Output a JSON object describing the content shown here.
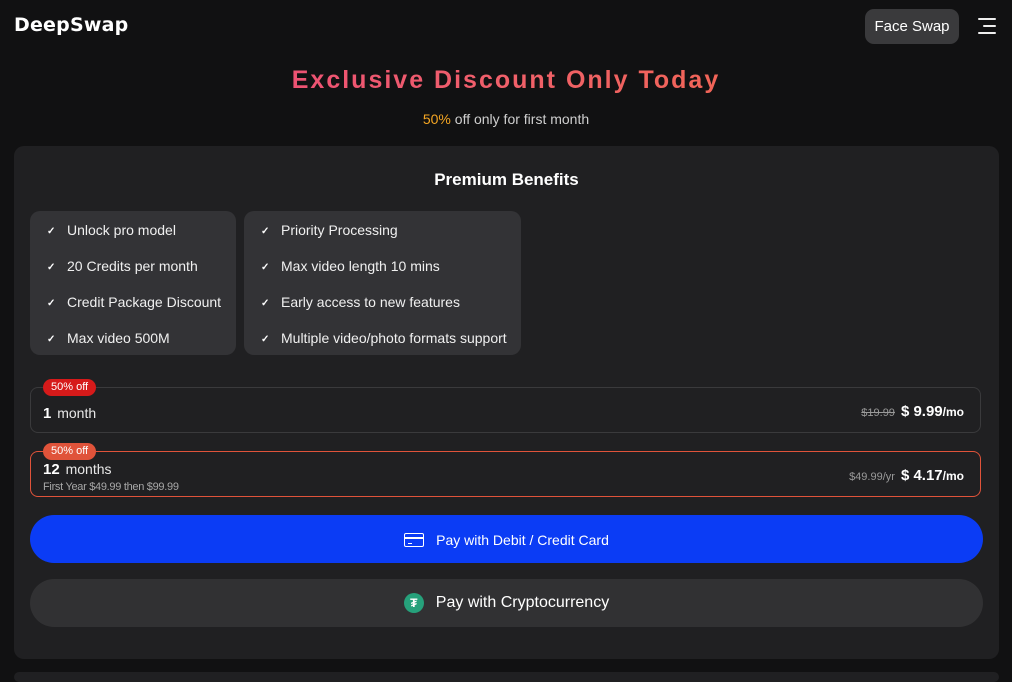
{
  "header": {
    "logo_text": "DeepSwap",
    "face_swap_label": "Face Swap",
    "menu_icon": "hamburger-menu-icon"
  },
  "promo": {
    "headline": "Exclusive Discount Only Today",
    "discount_pct": "50%",
    "discount_text": " off only for first month"
  },
  "benefits": {
    "title": "Premium Benefits",
    "left": [
      "Unlock pro model",
      "20 Credits per month",
      "Credit Package Discount",
      "Max video 500M"
    ],
    "right": [
      "Priority Processing",
      "Max video length 10 mins",
      "Early access to new features",
      "Multiple video/photo formats support"
    ]
  },
  "plans": [
    {
      "badge": "50% off",
      "qty": "1",
      "period": "month",
      "note": "",
      "old_price": "$19.99",
      "new_price": "$ 9.99",
      "unit": "/mo",
      "selected": false
    },
    {
      "badge": "50% off",
      "qty": "12",
      "period": "months",
      "note": "First Year $49.99 then $99.99",
      "old_price": "$49.99/yr",
      "new_price": "$ 4.17",
      "unit": "/mo",
      "selected": true
    }
  ],
  "payment": {
    "card_label": "Pay with Debit / Credit Card",
    "crypto_label": "Pay with Cryptocurrency",
    "crypto_symbol": "₮"
  },
  "colors": {
    "accent_blue": "#0b3cf5",
    "badge_red": "#d61a1a",
    "selected_border": "#e0533a",
    "highlight_orange": "#f5a623"
  }
}
